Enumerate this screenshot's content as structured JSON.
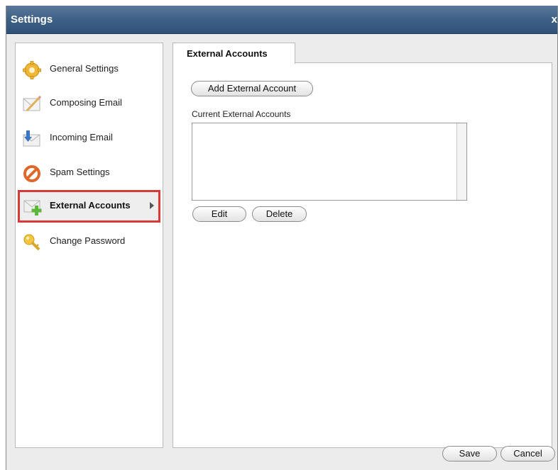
{
  "window": {
    "title": "Settings",
    "close_label": "x"
  },
  "sidebar": {
    "items": [
      {
        "label": "General Settings",
        "icon": "gear-icon",
        "active": false
      },
      {
        "label": "Composing Email",
        "icon": "compose-icon",
        "active": false
      },
      {
        "label": "Incoming Email",
        "icon": "incoming-icon",
        "active": false
      },
      {
        "label": "Spam Settings",
        "icon": "no-entry-icon",
        "active": false
      },
      {
        "label": "External Accounts",
        "icon": "add-account-icon",
        "active": true
      },
      {
        "label": "Change Password",
        "icon": "key-icon",
        "active": false
      }
    ]
  },
  "main": {
    "tab_label": "External Accounts",
    "add_button_label": "Add External Account",
    "list_label": "Current External Accounts",
    "accounts": [],
    "edit_label": "Edit",
    "delete_label": "Delete"
  },
  "footer": {
    "save_label": "Save",
    "cancel_label": "Cancel"
  },
  "colors": {
    "titlebar": "#3f6086",
    "active_outline": "#d83a3a",
    "panel_border": "#b9b9b9"
  }
}
